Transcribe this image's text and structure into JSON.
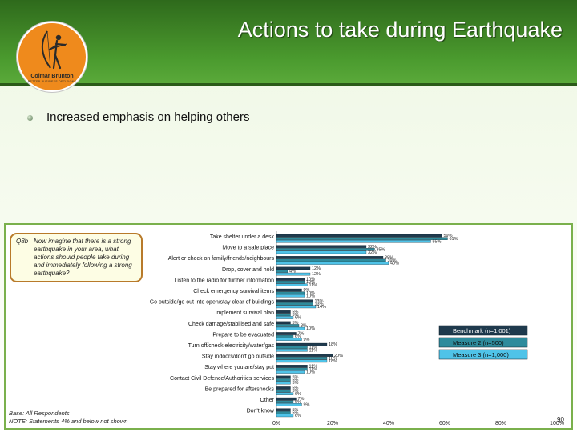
{
  "slide": {
    "title": "Actions to take during Earthquake",
    "bullet": "Increased emphasis on helping others",
    "page_number": "90"
  },
  "logo": {
    "name": "Colmar Brunton",
    "tagline": "BETTER BUSINESS DECISIONS"
  },
  "question": {
    "code": "Q8b",
    "text": "Now imagine that there is a strong earthquake in your area, what actions should people take during and immediately following a strong earthquake?"
  },
  "notes": {
    "base": "Base: All Respondents",
    "note": "NOTE: Statements 4% and below not shown"
  },
  "colors": {
    "header": "#3f8526",
    "benchmark": "#1f3a4d",
    "measure2": "#2e8b9c",
    "measure3": "#4fc3e8"
  },
  "chart_data": {
    "type": "bar",
    "orientation": "horizontal",
    "categories": [
      "Take shelter under a desk",
      "Move to a safe place",
      "Alert or check on family/friends/neighbours",
      "Drop, cover and hold",
      "Listen to the radio for further information",
      "Check emergency survival items",
      "Go outside/go out into open/stay clear of buildings",
      "Implement survival plan",
      "Check damage/stabilised and safe",
      "Prepare to be evacuated",
      "Turn off/check electricity/water/gas",
      "Stay indoors/don't go outside",
      "Stay where you are/stay put",
      "Contact Civil Defence/Authorities services",
      "Be prepared for aftershocks",
      "Other",
      "Don't know"
    ],
    "series": [
      {
        "name": "Benchmark (n=1,001)",
        "values": [
          59,
          32,
          38,
          12,
          10,
          9,
          13,
          5,
          5,
          7,
          18,
          20,
          11,
          5,
          5,
          7,
          5
        ]
      },
      {
        "name": "Measure 2 (n=500)",
        "values": [
          61,
          35,
          39,
          4,
          10,
          10,
          13,
          5,
          8,
          6,
          11,
          18,
          11,
          5,
          5,
          6,
          5
        ]
      },
      {
        "name": "Measure 3 (n=1,000)",
        "values": [
          55,
          32,
          40,
          12,
          11,
          10,
          14,
          6,
          10,
          9,
          11,
          18,
          10,
          5,
          6,
          9,
          6
        ]
      }
    ],
    "value_suffix": "%",
    "xlim": [
      0,
      100
    ],
    "xticks": [
      "0%",
      "20%",
      "40%",
      "60%",
      "80%",
      "100%"
    ],
    "legend_position": "right"
  }
}
